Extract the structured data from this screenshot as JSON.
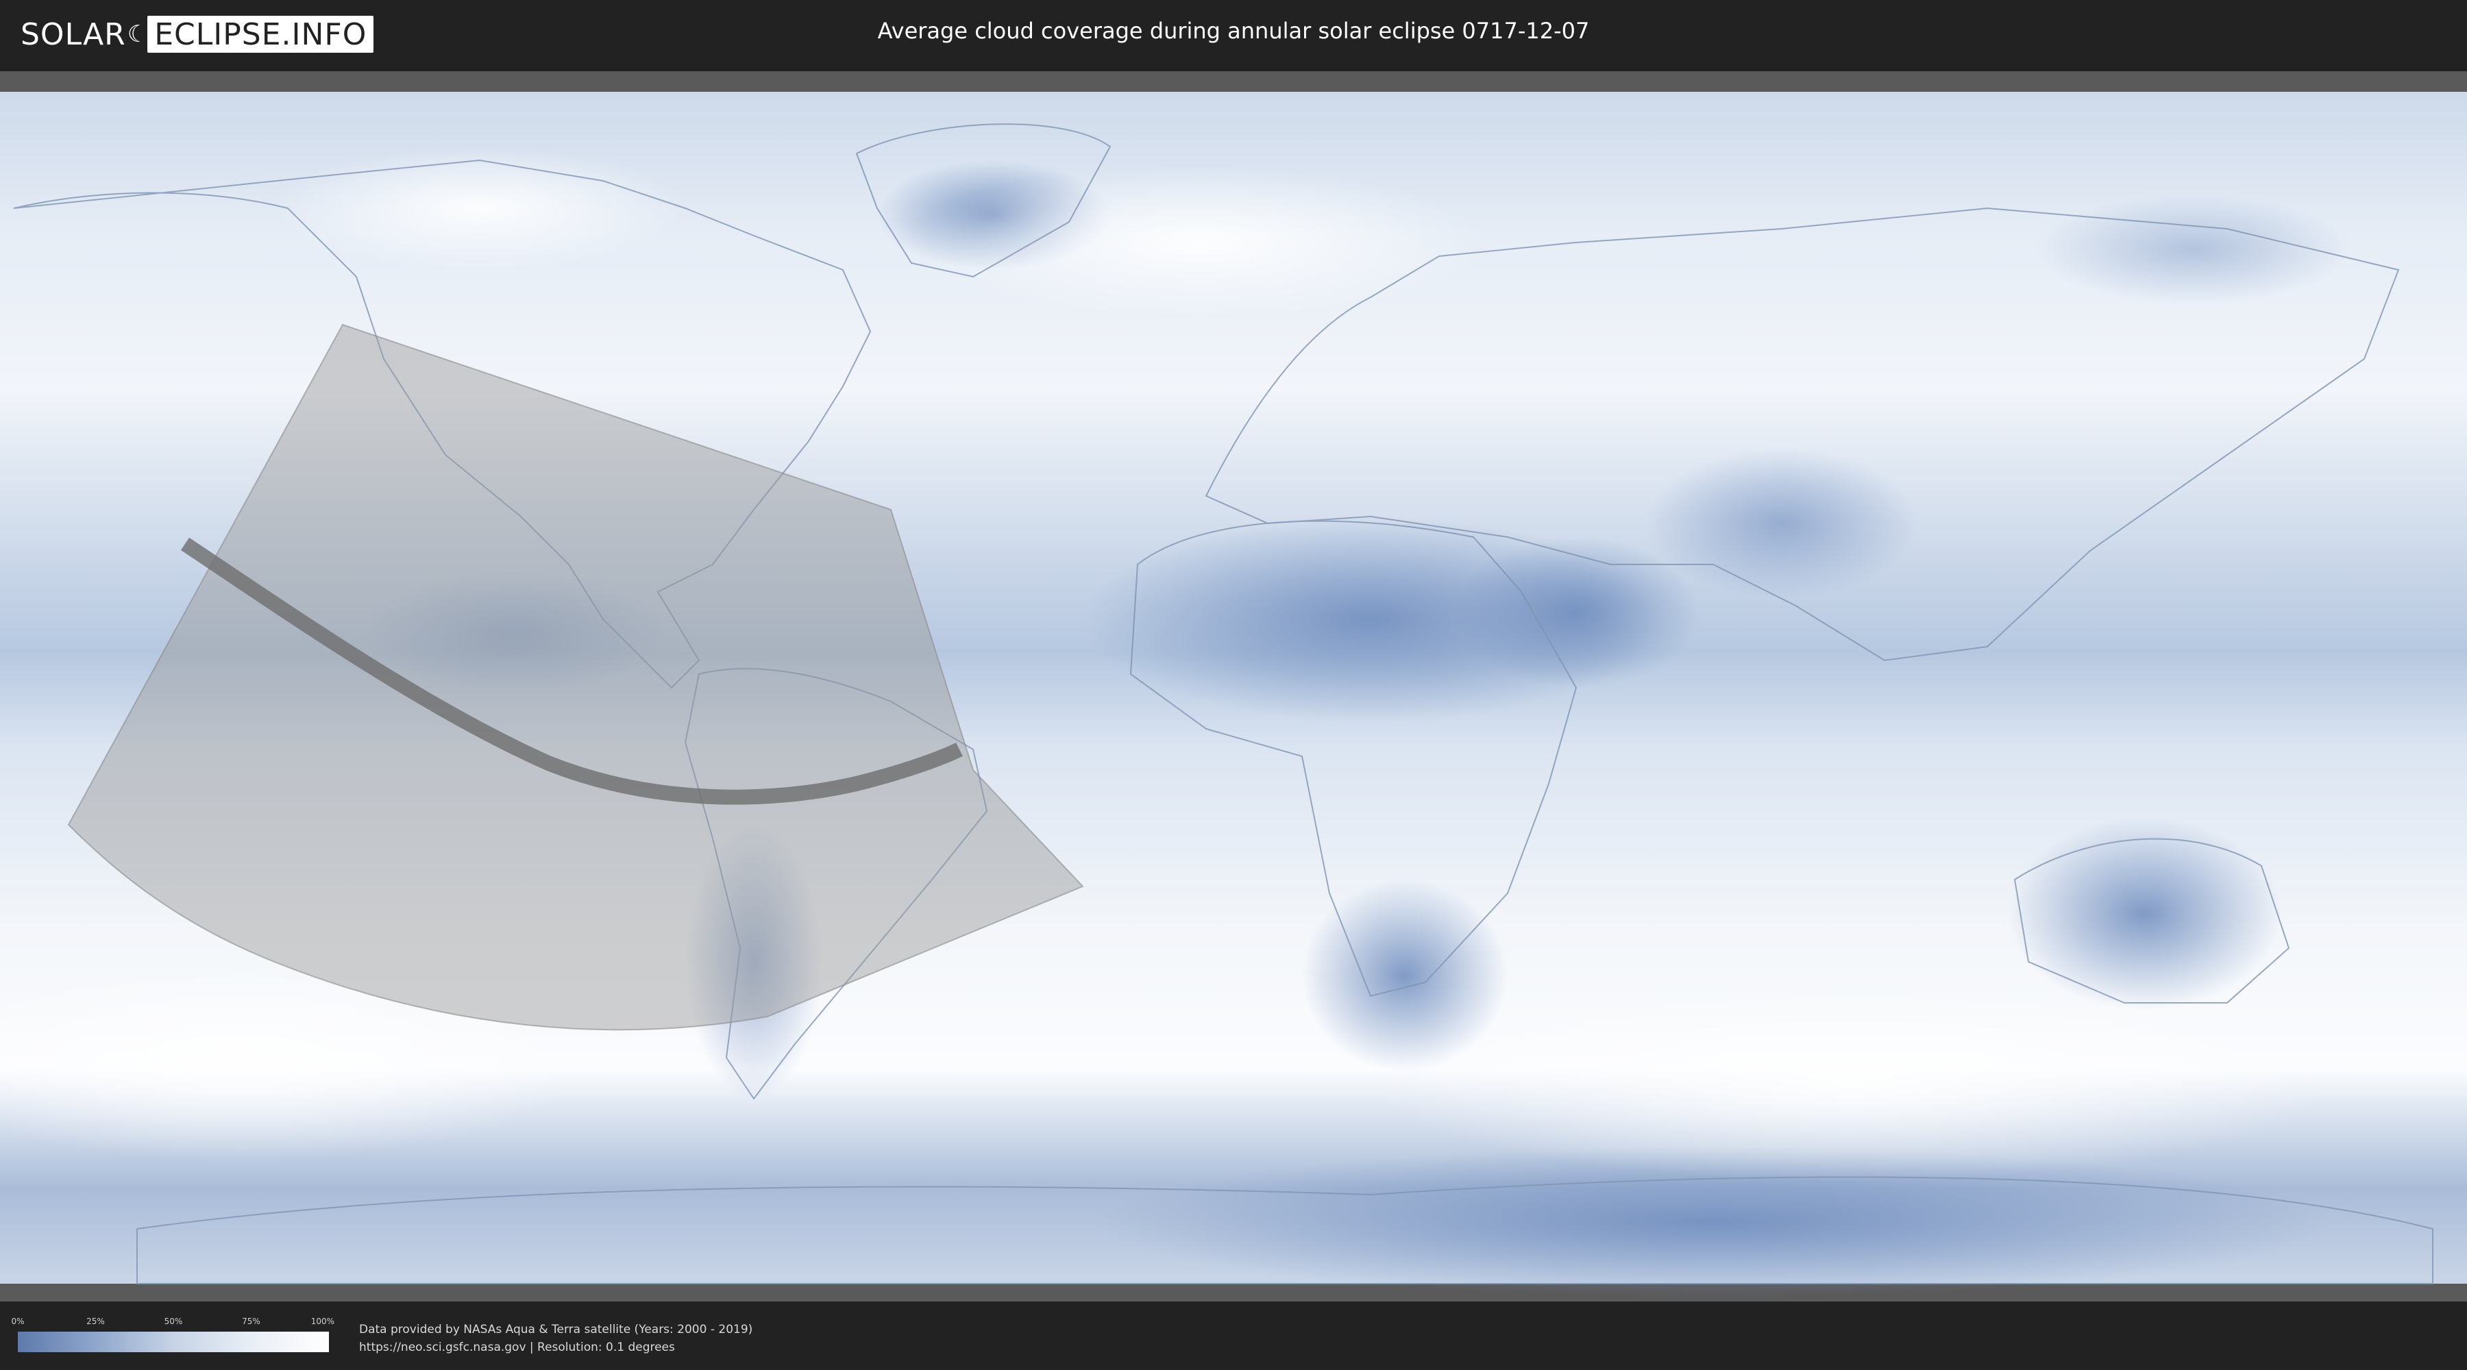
{
  "header": {
    "logo": {
      "part1": "SOLAR",
      "part2": "ECLIPSE.INFO"
    },
    "title": "Average cloud coverage during annular solar eclipse 0717-12-07"
  },
  "map": {
    "colors": {
      "clear": "#5f7fb3",
      "cloudy": "#ffffff",
      "eclipse_zone": "#8c8c8c",
      "central_path": "#6e6e6e",
      "frame": "#5a5a5a"
    }
  },
  "legend": {
    "ticks": [
      "0%",
      "25%",
      "50%",
      "75%",
      "100%"
    ]
  },
  "footer": {
    "line1": "Data provided by NASAs Aqua & Terra satellite (Years: 2000 - 2019)",
    "line2": "https://neo.sci.gsfc.nasa.gov | Resolution: 0.1 degrees"
  }
}
